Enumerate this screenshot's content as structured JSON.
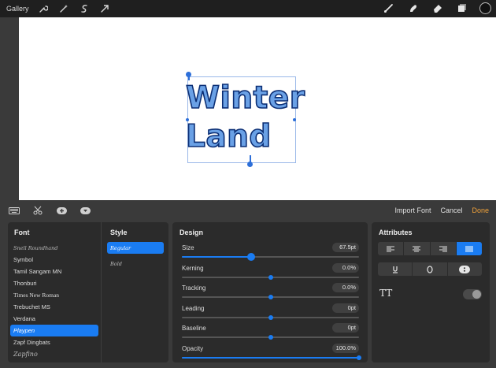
{
  "toolbar": {
    "gallery_label": "Gallery"
  },
  "canvas": {
    "text_line1": "Winter",
    "text_line2": "Land"
  },
  "panel_bar": {
    "import_font": "Import Font",
    "cancel": "Cancel",
    "done": "Done"
  },
  "font_panel": {
    "header": "Font",
    "items": [
      "Snell Roundhand",
      "Symbol",
      "Tamil Sangam MN",
      "Thonburi",
      "Times New Roman",
      "Trebuchet MS",
      "Verdana",
      "Playpen",
      "Zapf Dingbats",
      "Zapfino"
    ],
    "selected_index": 7
  },
  "style_panel": {
    "header": "Style",
    "items": [
      "Regular",
      "Bold"
    ],
    "selected_index": 0
  },
  "design_panel": {
    "header": "Design",
    "rows": [
      {
        "label": "Size",
        "value": "67.5pt",
        "fraction": 0.39
      },
      {
        "label": "Kerning",
        "value": "0.0%",
        "fraction": 0.5
      },
      {
        "label": "Tracking",
        "value": "0.0%",
        "fraction": 0.5
      },
      {
        "label": "Leading",
        "value": "0pt",
        "fraction": 0.5
      },
      {
        "label": "Baseline",
        "value": "0pt",
        "fraction": 0.5
      },
      {
        "label": "Opacity",
        "value": "100.0%",
        "fraction": 1.0
      }
    ]
  },
  "attributes_panel": {
    "header": "Attributes",
    "alignment_selected": "justify",
    "style_toggle_label": "TT",
    "outline_toggle_on": false
  },
  "colors": {
    "accent": "#1a7cf2",
    "done": "#f0a23a",
    "text_fill": "#6aa1e6",
    "text_outline": "#0c2f75"
  }
}
